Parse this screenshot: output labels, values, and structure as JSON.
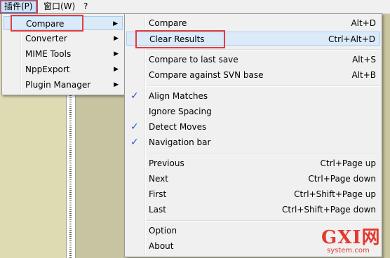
{
  "menubar": {
    "items": [
      {
        "label": "插件(P)"
      },
      {
        "label": "窗口(W)"
      },
      {
        "label": "?"
      }
    ]
  },
  "plugin_menu": {
    "items": [
      {
        "label": "Compare",
        "submenu": true
      },
      {
        "label": "Converter",
        "submenu": true
      },
      {
        "label": "MIME Tools",
        "submenu": true
      },
      {
        "label": "NppExport",
        "submenu": true
      },
      {
        "label": "Plugin Manager",
        "submenu": true
      }
    ]
  },
  "compare_menu": {
    "items": [
      {
        "label": "Compare",
        "shortcut": "Alt+D",
        "checked": false
      },
      {
        "label": "Clear Results",
        "shortcut": "Ctrl+Alt+D",
        "checked": false
      },
      {
        "label": "Compare to last save",
        "shortcut": "Alt+S",
        "checked": false
      },
      {
        "label": "Compare against SVN base",
        "shortcut": "Alt+B",
        "checked": false
      },
      {
        "label": "Align Matches",
        "shortcut": "",
        "checked": true
      },
      {
        "label": "Ignore Spacing",
        "shortcut": "",
        "checked": false
      },
      {
        "label": "Detect Moves",
        "shortcut": "",
        "checked": true
      },
      {
        "label": "Navigation bar",
        "shortcut": "",
        "checked": true
      },
      {
        "label": "Previous",
        "shortcut": "Ctrl+Page up",
        "checked": false
      },
      {
        "label": "Next",
        "shortcut": "Ctrl+Page down",
        "checked": false
      },
      {
        "label": "First",
        "shortcut": "Ctrl+Shift+Page up",
        "checked": false
      },
      {
        "label": "Last",
        "shortcut": "Ctrl+Shift+Page down",
        "checked": false
      },
      {
        "label": "Option",
        "shortcut": "",
        "checked": false
      },
      {
        "label": "About",
        "shortcut": "",
        "checked": false
      }
    ]
  },
  "icons": {
    "submenu_arrow": "triangle-right-icon",
    "check": "checkmark-icon"
  },
  "colors": {
    "highlight_box": "#e53b3b",
    "check": "#2a59c8",
    "watermark": "#e5392f"
  },
  "watermark": {
    "main": "GXI网",
    "sub": "system.com"
  }
}
